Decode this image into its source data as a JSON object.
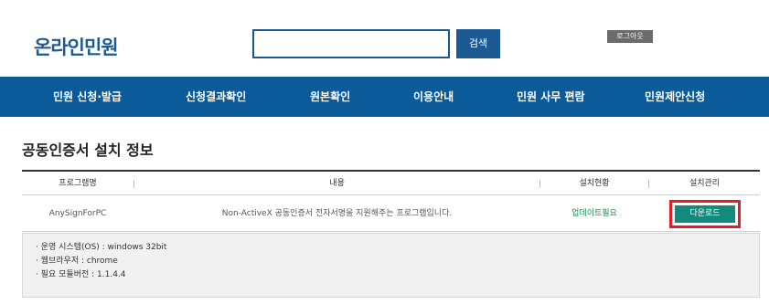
{
  "header": {
    "logo": "온라인민원",
    "search": {
      "value": "",
      "placeholder": "",
      "button_label": "검색"
    },
    "logout_label": "로그아웃"
  },
  "nav": {
    "items": [
      {
        "label": "민원 신청·발급"
      },
      {
        "label": "신청결과확인"
      },
      {
        "label": "원본확인"
      },
      {
        "label": "이용안내"
      },
      {
        "label": "민원 사무 편람"
      },
      {
        "label": "민원제안신청"
      }
    ]
  },
  "main": {
    "title": "공동인증서 설치 정보",
    "table": {
      "columns": [
        "프로그램명",
        "내용",
        "설치현황",
        "설치관리"
      ],
      "rows": [
        {
          "program": "AnySignForPC",
          "description": "Non-ActiveX 공동인증서 전자서명을 지원해주는 프로그램입니다.",
          "status": "업데이트필요",
          "action_label": "다운로드"
        }
      ]
    },
    "info": [
      "· 운영 시스템(OS) : windows 32bit",
      "· 웹브라우저 : chrome",
      "· 필요 모듈버전 : 1.1.4.4"
    ]
  },
  "colors": {
    "brand": "#0b5a9a",
    "download_button": "#138a7c",
    "highlight_outline": "#e01f26",
    "status_text": "#1a8a4a"
  }
}
